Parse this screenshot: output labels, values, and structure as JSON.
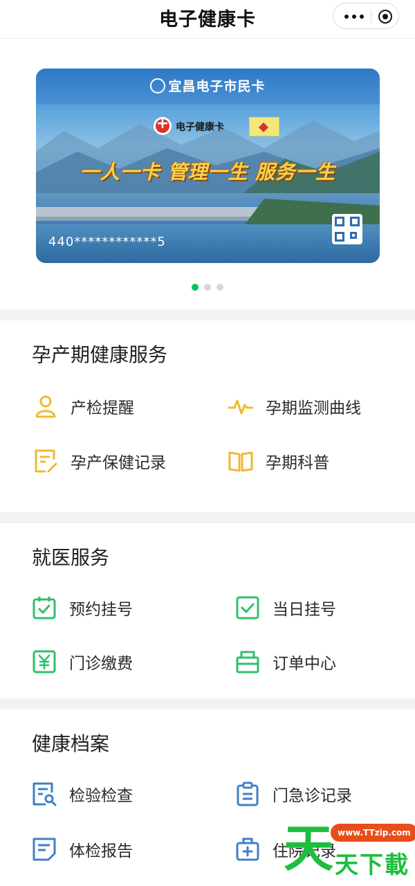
{
  "header": {
    "title": "电子健康卡"
  },
  "card": {
    "brand": "宜昌电子市民卡",
    "health_label": "电子健康卡",
    "slogan": "一人一卡 管理一生 服务一生",
    "number": "440************5"
  },
  "carousel": {
    "pages": 3,
    "active": 1
  },
  "sections": [
    {
      "title": "孕产期健康服务",
      "items": [
        {
          "label": "产检提醒",
          "icon": "person-icon"
        },
        {
          "label": "孕期监测曲线",
          "icon": "pulse-icon"
        },
        {
          "label": "孕产保健记录",
          "icon": "edit-record-icon"
        },
        {
          "label": "孕期科普",
          "icon": "book-icon"
        }
      ]
    },
    {
      "title": "就医服务",
      "items": [
        {
          "label": "预约挂号",
          "icon": "calendar-check-icon"
        },
        {
          "label": "当日挂号",
          "icon": "check-square-icon"
        },
        {
          "label": "门诊缴费",
          "icon": "yuan-icon"
        },
        {
          "label": "订单中心",
          "icon": "briefcase-icon"
        }
      ]
    },
    {
      "title": "健康档案",
      "items": [
        {
          "label": "检验检查",
          "icon": "doc-search-icon"
        },
        {
          "label": "门急诊记录",
          "icon": "clipboard-icon"
        },
        {
          "label": "体检报告",
          "icon": "report-icon"
        },
        {
          "label": "住院记录",
          "icon": "medical-kit-icon"
        }
      ]
    }
  ],
  "colors": {
    "maternal": "#f0b92e",
    "medical": "#2fbf6a",
    "records": "#3f7fc6",
    "accent": "#07c160"
  },
  "watermark": {
    "logo_char": "天",
    "url": "www.TTzip.com",
    "text": "天下載"
  }
}
